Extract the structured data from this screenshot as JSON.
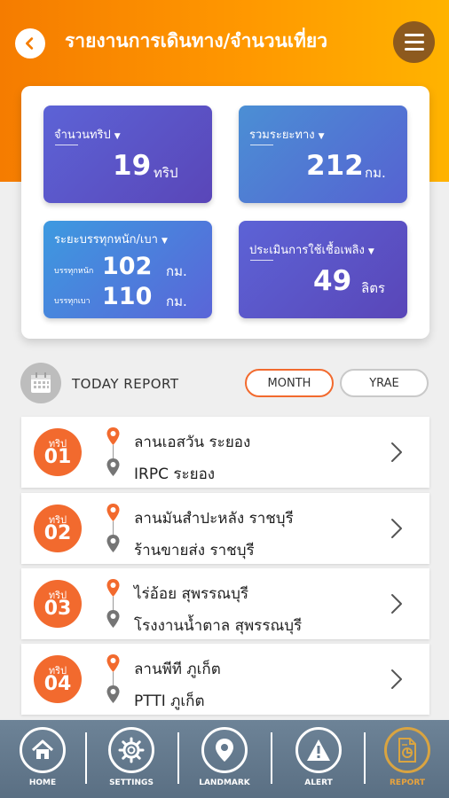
{
  "header": {
    "title": "รายงานการเดินทาง/จำนวนเที่ยว",
    "back_icon": "back-arrow-icon",
    "menu_icon": "hamburger-menu-icon"
  },
  "stats": {
    "trips": {
      "label": "จำนวนทริป",
      "value": "19",
      "unit": "ทริป"
    },
    "distance": {
      "label": "รวมระยะทาง",
      "value": "212",
      "unit": "กม."
    },
    "load": {
      "label": "ระยะบรรทุกหนัก/เบา",
      "heavy_label": "บรรทุกหนัก",
      "heavy_value": "102",
      "heavy_unit": "กม.",
      "light_label": "บรรทุกเบา",
      "light_value": "110",
      "light_unit": "กม."
    },
    "fuel": {
      "label": "ประเมินการใช้เชื้อเพลิง",
      "value": "49",
      "unit": "ลิตร"
    }
  },
  "report": {
    "today_label": "TODAY REPORT",
    "month_label": "MONTH",
    "year_label": "YRAE"
  },
  "trips": [
    {
      "tag": "ทริป",
      "number": "01",
      "from": "ลานเอสวัน ระยอง",
      "to": "IRPC ระยอง"
    },
    {
      "tag": "ทริป",
      "number": "02",
      "from": "ลานมันสำปะหลัง ราชบุรี",
      "to": "ร้านขายส่ง ราชบุรี"
    },
    {
      "tag": "ทริป",
      "number": "03",
      "from": "ไร่อ้อย สุพรรณบุรี",
      "to": "โรงงานน้ำตาล สุพรรณบุรี"
    },
    {
      "tag": "ทริป",
      "number": "04",
      "from": "ลานพีที ภูเก็ต",
      "to": "PTTI ภูเก็ต"
    }
  ],
  "nav": {
    "home": "HOME",
    "settings": "SETTINGS",
    "landmark": "LANDMARK",
    "alert": "ALERT",
    "report": "REPORT"
  },
  "colors": {
    "header_orange": "#f57c00",
    "accent": "#f26a2e",
    "card_purple": "#5a46b8",
    "nav_bg": "#5a6f83",
    "active_nav": "#e8a33d"
  }
}
